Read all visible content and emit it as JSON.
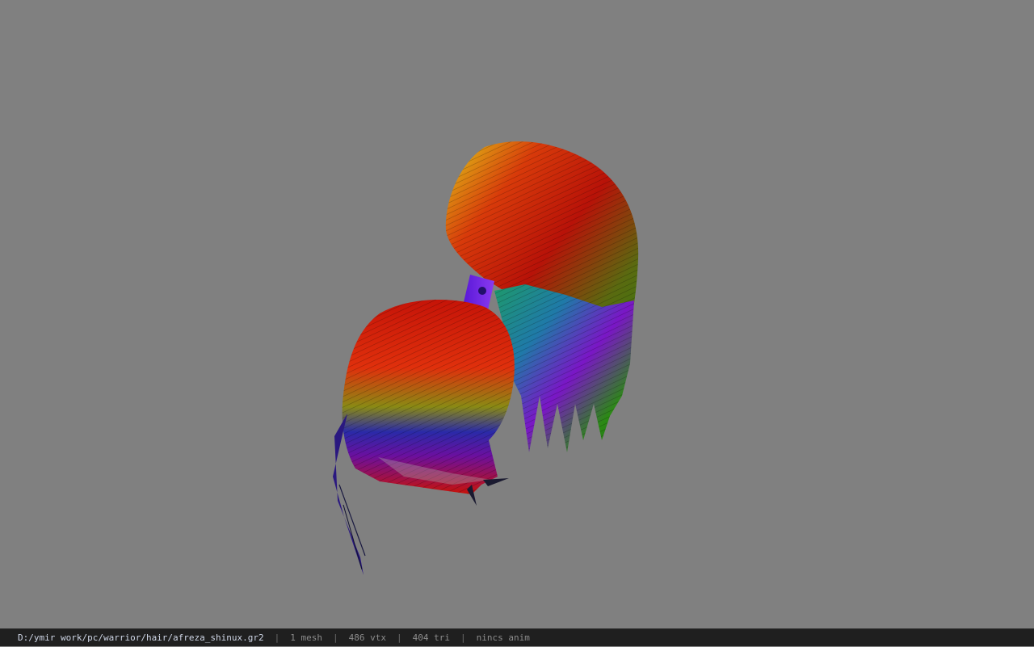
{
  "viewport": {
    "background": "#808080",
    "model_name": "afreza_shinux",
    "hair_colors": [
      "#d41a08",
      "#e8c010",
      "#2e8a10",
      "#1a6aa0",
      "#7a12c8",
      "#2a1a9a"
    ]
  },
  "status_bar": {
    "file_path": "D:/ymir work/pc/warrior/hair/afreza_shinux.gr2",
    "separator": "|",
    "mesh_count": "1 mesh",
    "vertex_count": "486 vtx",
    "triangle_count": "404 tri",
    "anim_status": "nincs anim"
  }
}
